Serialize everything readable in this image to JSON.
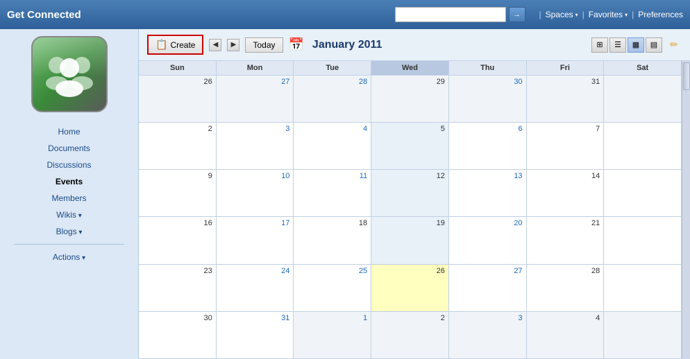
{
  "app": {
    "title": "Get Connected"
  },
  "topbar": {
    "search_placeholder": "",
    "search_btn_icon": "→",
    "nav_separator": "|",
    "spaces_label": "Spaces",
    "favorites_label": "Favorites",
    "preferences_label": "Preferences"
  },
  "sidebar": {
    "nav_items": [
      {
        "label": "Home",
        "active": false,
        "has_arrow": false
      },
      {
        "label": "Documents",
        "active": false,
        "has_arrow": false
      },
      {
        "label": "Discussions",
        "active": false,
        "has_arrow": false
      },
      {
        "label": "Events",
        "active": true,
        "has_arrow": false
      },
      {
        "label": "Members",
        "active": false,
        "has_arrow": false
      },
      {
        "label": "Wikis",
        "active": false,
        "has_arrow": true
      },
      {
        "label": "Blogs",
        "active": false,
        "has_arrow": true
      }
    ],
    "actions_label": "Actions"
  },
  "calendar": {
    "create_label": "Create",
    "today_label": "Today",
    "month_title": "January 2011",
    "days": [
      "Sun",
      "Mon",
      "Tue",
      "Wed",
      "Thu",
      "Fri",
      "Sat"
    ],
    "today_col": 3,
    "weeks": [
      [
        {
          "num": "26",
          "other": true,
          "clickable": false
        },
        {
          "num": "27",
          "other": true,
          "clickable": true
        },
        {
          "num": "28",
          "other": true,
          "clickable": true
        },
        {
          "num": "29",
          "other": true,
          "clickable": false
        },
        {
          "num": "30",
          "other": true,
          "clickable": true
        },
        {
          "num": "31",
          "other": true,
          "clickable": false
        },
        {
          "num": "",
          "other": true,
          "clickable": false
        }
      ],
      [
        {
          "num": "2",
          "other": false,
          "clickable": false
        },
        {
          "num": "3",
          "other": false,
          "clickable": true
        },
        {
          "num": "4",
          "other": false,
          "clickable": true
        },
        {
          "num": "5",
          "other": false,
          "clickable": false
        },
        {
          "num": "6",
          "other": false,
          "clickable": true
        },
        {
          "num": "7",
          "other": false,
          "clickable": false
        },
        {
          "num": "",
          "other": false,
          "clickable": false
        }
      ],
      [
        {
          "num": "9",
          "other": false,
          "clickable": false
        },
        {
          "num": "10",
          "other": false,
          "clickable": true
        },
        {
          "num": "11",
          "other": false,
          "clickable": true
        },
        {
          "num": "12",
          "other": false,
          "clickable": false
        },
        {
          "num": "13",
          "other": false,
          "clickable": true
        },
        {
          "num": "14",
          "other": false,
          "clickable": false
        },
        {
          "num": "",
          "other": false,
          "clickable": false
        }
      ],
      [
        {
          "num": "16",
          "other": false,
          "clickable": false
        },
        {
          "num": "17",
          "other": false,
          "clickable": true
        },
        {
          "num": "18",
          "other": false,
          "clickable": false
        },
        {
          "num": "19",
          "other": false,
          "clickable": false
        },
        {
          "num": "20",
          "other": false,
          "clickable": true
        },
        {
          "num": "21",
          "other": false,
          "clickable": false
        },
        {
          "num": "",
          "other": false,
          "clickable": false
        }
      ],
      [
        {
          "num": "23",
          "other": false,
          "clickable": false
        },
        {
          "num": "24",
          "other": false,
          "clickable": true
        },
        {
          "num": "25",
          "other": false,
          "clickable": true
        },
        {
          "num": "26",
          "other": false,
          "highlight": true,
          "clickable": false
        },
        {
          "num": "27",
          "other": false,
          "clickable": true
        },
        {
          "num": "28",
          "other": false,
          "clickable": false
        },
        {
          "num": "",
          "other": false,
          "clickable": false
        }
      ],
      [
        {
          "num": "30",
          "other": false,
          "clickable": false
        },
        {
          "num": "31",
          "other": false,
          "clickable": true
        },
        {
          "num": "1",
          "other": true,
          "clickable": true
        },
        {
          "num": "2",
          "other": true,
          "clickable": false
        },
        {
          "num": "3",
          "other": true,
          "clickable": true
        },
        {
          "num": "4",
          "other": true,
          "clickable": false
        },
        {
          "num": "",
          "other": true,
          "clickable": false
        }
      ]
    ],
    "view_btns": [
      "month-grid-icon",
      "week-list-icon",
      "month-block-icon",
      "week-block-icon"
    ],
    "active_view": 2
  }
}
